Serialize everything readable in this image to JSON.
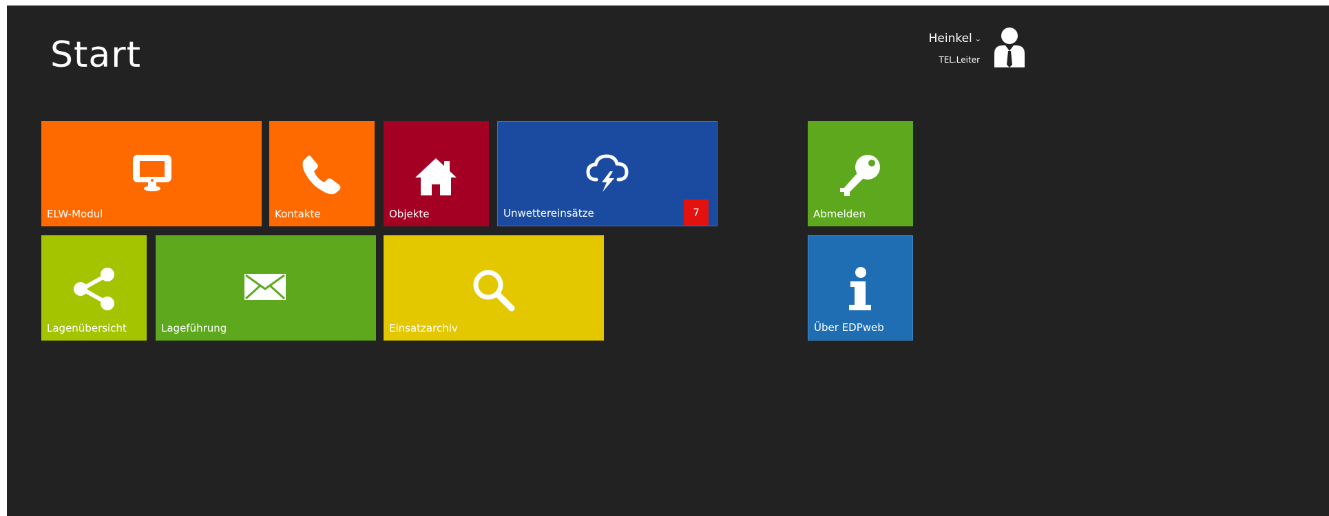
{
  "page": {
    "title": "Start"
  },
  "user": {
    "name": "Heinkel",
    "role": "TEL.Leiter",
    "dropdown_glyph": "⌄",
    "avatar_icon": "user-avatar-icon"
  },
  "tiles": [
    {
      "id": "elw-modul",
      "label": "ELW-Modul",
      "color": "#ff6a00",
      "icon": "monitor-icon"
    },
    {
      "id": "kontakte",
      "label": "Kontakte",
      "color": "#ff6a00",
      "icon": "phone-icon"
    },
    {
      "id": "objekte",
      "label": "Objekte",
      "color": "#a30023",
      "icon": "home-icon"
    },
    {
      "id": "unwettereinsaetze",
      "label": "Unwettereinsätze",
      "color": "#1b4ba0",
      "icon": "storm-cloud-icon",
      "badge": "7",
      "badge_color": "#e3120e"
    },
    {
      "id": "abmelden",
      "label": "Abmelden",
      "color": "#5ea81e",
      "icon": "key-icon"
    },
    {
      "id": "lagenuebersicht",
      "label": "Lagenübersicht",
      "color": "#a5c400",
      "icon": "share-icon"
    },
    {
      "id": "lagefuehrung",
      "label": "Lageführung",
      "color": "#5ea81e",
      "icon": "envelope-icon"
    },
    {
      "id": "einsatzarchiv",
      "label": "Einsatzarchiv",
      "color": "#e3c800",
      "icon": "search-icon"
    },
    {
      "id": "ueber-edpweb",
      "label": "Über EDPweb",
      "color": "#1f6eb3",
      "icon": "info-icon"
    }
  ]
}
